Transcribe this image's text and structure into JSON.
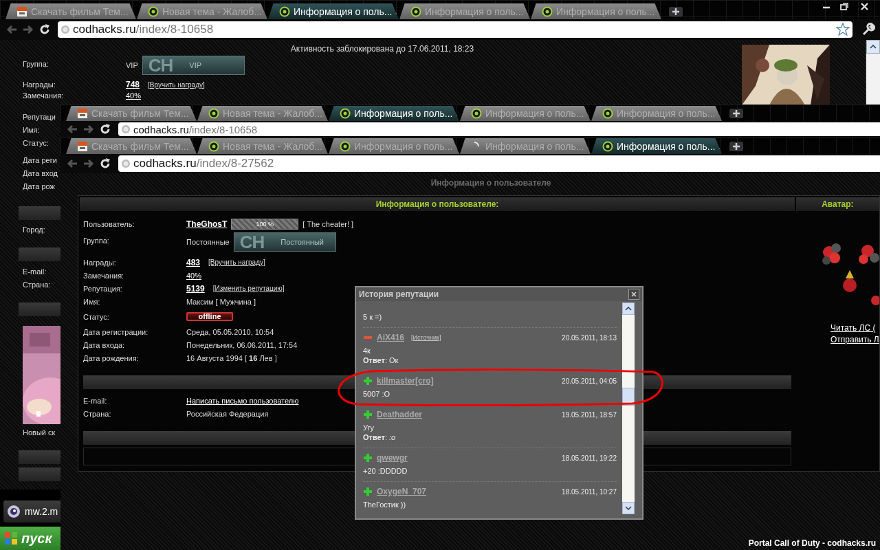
{
  "back_window": {
    "tabs": [
      {
        "title": "Скачать фильм Тем...",
        "kind": "video",
        "selected": false
      },
      {
        "title": "Новая тема - Жалоб...",
        "kind": "forum",
        "selected": false
      },
      {
        "title": "Информация о поль...",
        "kind": "forum",
        "selected": true
      },
      {
        "title": "Информация о поль...",
        "kind": "forum",
        "selected": false
      },
      {
        "title": "Информация о поль...",
        "kind": "forum",
        "selected": false
      }
    ],
    "address": {
      "host": "codhacks.ru",
      "path": "/index/8-10658"
    },
    "page": {
      "notice": "Активность заблокирована до 17.06.2011, 18:23",
      "rows": [
        {
          "kind": "group",
          "label": "Группа:",
          "value": "VIP",
          "badge": {
            "logo": "CH",
            "label": "VIP"
          }
        },
        {
          "kind": "count",
          "label": "Награды:",
          "value": "748",
          "action": "[Вручить награду]"
        },
        {
          "kind": "link",
          "label": "Замечания:",
          "value": "40%"
        }
      ],
      "side_sections": [
        {
          "kind": "labels",
          "labels": [
            "Репутаци",
            "Имя:",
            "Статус:"
          ]
        },
        {
          "kind": "labels",
          "labels": [
            "Дата реги",
            "Дата вход",
            "Дата рож"
          ]
        },
        {
          "kind": "bar"
        },
        {
          "kind": "labels",
          "labels": [
            "Город:"
          ]
        },
        {
          "kind": "bar"
        },
        {
          "kind": "labels",
          "labels": [
            "E-mail:",
            "Страна:"
          ]
        },
        {
          "kind": "bar"
        },
        {
          "kind": "picture",
          "caption": "Новый ск"
        },
        {
          "kind": "bar"
        },
        {
          "kind": "bar"
        }
      ]
    }
  },
  "middle_window": {
    "tabs": [
      {
        "title": "Скачать фильм Тем...",
        "kind": "video",
        "selected": false
      },
      {
        "title": "Новая тема - Жалоб...",
        "kind": "forum",
        "selected": false
      },
      {
        "title": "Информация о поль...",
        "kind": "forum",
        "selected": true
      },
      {
        "title": "Информация о поль...",
        "kind": "forum",
        "selected": false
      },
      {
        "title": "Информация о поль...",
        "kind": "forum",
        "selected": false
      }
    ],
    "address": {
      "host": "codhacks.ru",
      "path": "/index/8-10658"
    }
  },
  "front_window": {
    "tabs": [
      {
        "title": "Скачать фильм Тем...",
        "kind": "video",
        "selected": false
      },
      {
        "title": "Новая тема - Жалоб...",
        "kind": "forum",
        "selected": false
      },
      {
        "title": "Информация о поль...",
        "kind": "forum",
        "selected": false
      },
      {
        "title": "Информация о поль...",
        "kind": "loading",
        "selected": false
      },
      {
        "title": "Информация о поль...",
        "kind": "forum",
        "selected": true
      }
    ],
    "address": {
      "host": "codhacks.ru",
      "path": "/index/8-27562"
    },
    "page": {
      "heading": "Информация о пользователе",
      "panel_title": "Информация о пользователе:",
      "avatar_title": "Аватар:",
      "rows": [
        {
          "kind": "user",
          "label": "Пользователь:",
          "value": "TheGhosT",
          "meter": {
            "level": 1,
            "reading": "100 %"
          },
          "note": "[ The cheater! ]"
        },
        {
          "kind": "group",
          "label": "Группа:",
          "value": "Постоянные",
          "badge": {
            "logo": "CH",
            "label": "Постоянный"
          }
        },
        {
          "kind": "count",
          "label": "Награды:",
          "value": "483",
          "action": "[Вручить награду]"
        },
        {
          "kind": "link",
          "label": "Замечания:",
          "value": "40%"
        },
        {
          "kind": "count",
          "label": "Репутация:",
          "value": "5139",
          "action": "[Изменить репутацию]"
        },
        {
          "kind": "text",
          "label": "Имя:",
          "value": "Максим [ Мужчина ]"
        },
        {
          "kind": "status",
          "label": "Статус:",
          "value": "offline"
        },
        {
          "kind": "text",
          "label": "Дата регистрации:",
          "value": "Среда, 05.05.2010, 10:54"
        },
        {
          "kind": "text",
          "label": "Дата входа:",
          "value": "Понедельник, 06.06.2011, 17:54"
        },
        {
          "kind": "text",
          "label": "Дата рождения:",
          "value": "16 Августа 1994 [ **16** Лев ]"
        }
      ],
      "contact_rows": [
        {
          "kind": "link",
          "label": "E-mail:",
          "value": "Написать письмо пользователю"
        },
        {
          "kind": "text",
          "label": "Страна:",
          "value": "Российская Федерация"
        }
      ],
      "avatar_links": [
        "Читать ЛС (",
        "Отправить Л"
      ],
      "footer": "Portal Call of Duty - codhacks.ru"
    }
  },
  "reputation_popup": {
    "title": "История репутации",
    "entries": [
      {
        "kind": "text_only",
        "text": "5 к =)"
      },
      {
        "kind": "minus",
        "user": "AiX416",
        "source": "[Источник]",
        "date": "20.05.2011, 18:13",
        "text": "4к",
        "reply": "**Ответ**: Ок"
      },
      {
        "kind": "plus",
        "user": "killmaster[cro]",
        "date": "20.05.2011, 04:05",
        "text": "5007 :O"
      },
      {
        "kind": "plus",
        "user": "Deathadder",
        "date": "19.05.2011, 18:57",
        "text": "Угу",
        "reply": "**Ответ**: *:o*"
      },
      {
        "kind": "plus",
        "user": "qwewgr",
        "date": "18.05.2011, 19:22",
        "text": "+20 :DDDDD"
      },
      {
        "kind": "plus",
        "user": "OxygeN_707",
        "date": "18.05.2011, 10:27",
        "text": "TheГостик ))"
      }
    ]
  },
  "taskbar": {
    "items": [
      {
        "label": "mw.2.m"
      }
    ],
    "start": "пуск"
  }
}
